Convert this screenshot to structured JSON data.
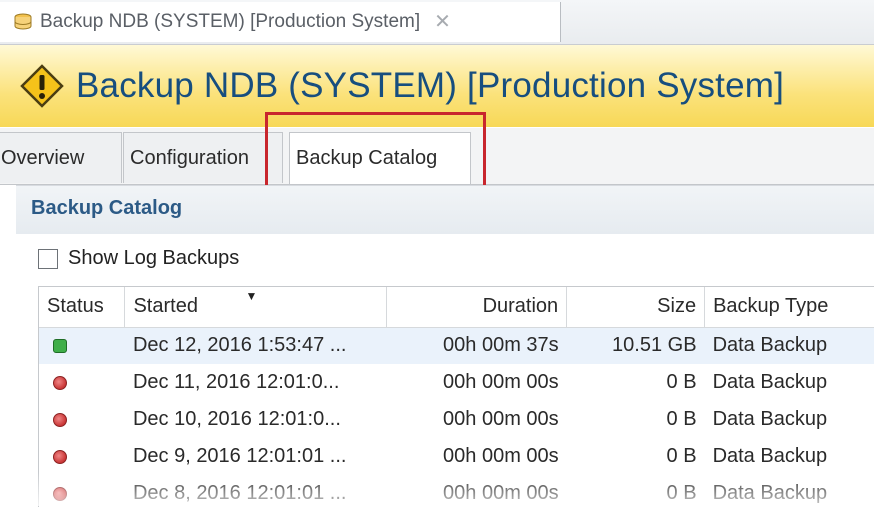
{
  "editor_tab": {
    "title": "Backup NDB (SYSTEM) [Production System]",
    "close_glyph": "✕",
    "icon": "database-icon"
  },
  "banner": {
    "title": "Backup NDB (SYSTEM) [Production System]",
    "icon": "warning-icon"
  },
  "tabs": [
    {
      "label": "Overview"
    },
    {
      "label": "Configuration"
    },
    {
      "label": "Backup Catalog",
      "selected": true
    }
  ],
  "catalog": {
    "section_title": "Backup Catalog",
    "show_log_backups": {
      "label": "Show Log Backups",
      "checked": false
    },
    "columns": {
      "status": "Status",
      "started": "Started",
      "duration": "Duration",
      "size": "Size",
      "backup_type": "Backup Type"
    },
    "sort_indicator": "▼",
    "rows": [
      {
        "status": "success",
        "started": "Dec 12, 2016 1:53:47 ...",
        "duration": "00h 00m 37s",
        "size": "10.51 GB",
        "backup_type": "Data Backup"
      },
      {
        "status": "failed",
        "started": "Dec 11, 2016 12:01:0...",
        "duration": "00h 00m 00s",
        "size": "0 B",
        "backup_type": "Data Backup"
      },
      {
        "status": "failed",
        "started": "Dec 10, 2016 12:01:0...",
        "duration": "00h 00m 00s",
        "size": "0 B",
        "backup_type": "Data Backup"
      },
      {
        "status": "failed",
        "started": "Dec 9, 2016 12:01:01 ...",
        "duration": "00h 00m 00s",
        "size": "0 B",
        "backup_type": "Data Backup"
      },
      {
        "status": "failed",
        "started": "Dec 8, 2016 12:01:01 ...",
        "duration": "00h 00m 00s",
        "size": "0 B",
        "backup_type": "Data Backup"
      }
    ]
  },
  "colors": {
    "banner_title": "#174e7f",
    "section_title": "#2c5a86",
    "highlight": "#c8262d",
    "status_success": "#3fae49",
    "status_failed": "#c93535"
  }
}
